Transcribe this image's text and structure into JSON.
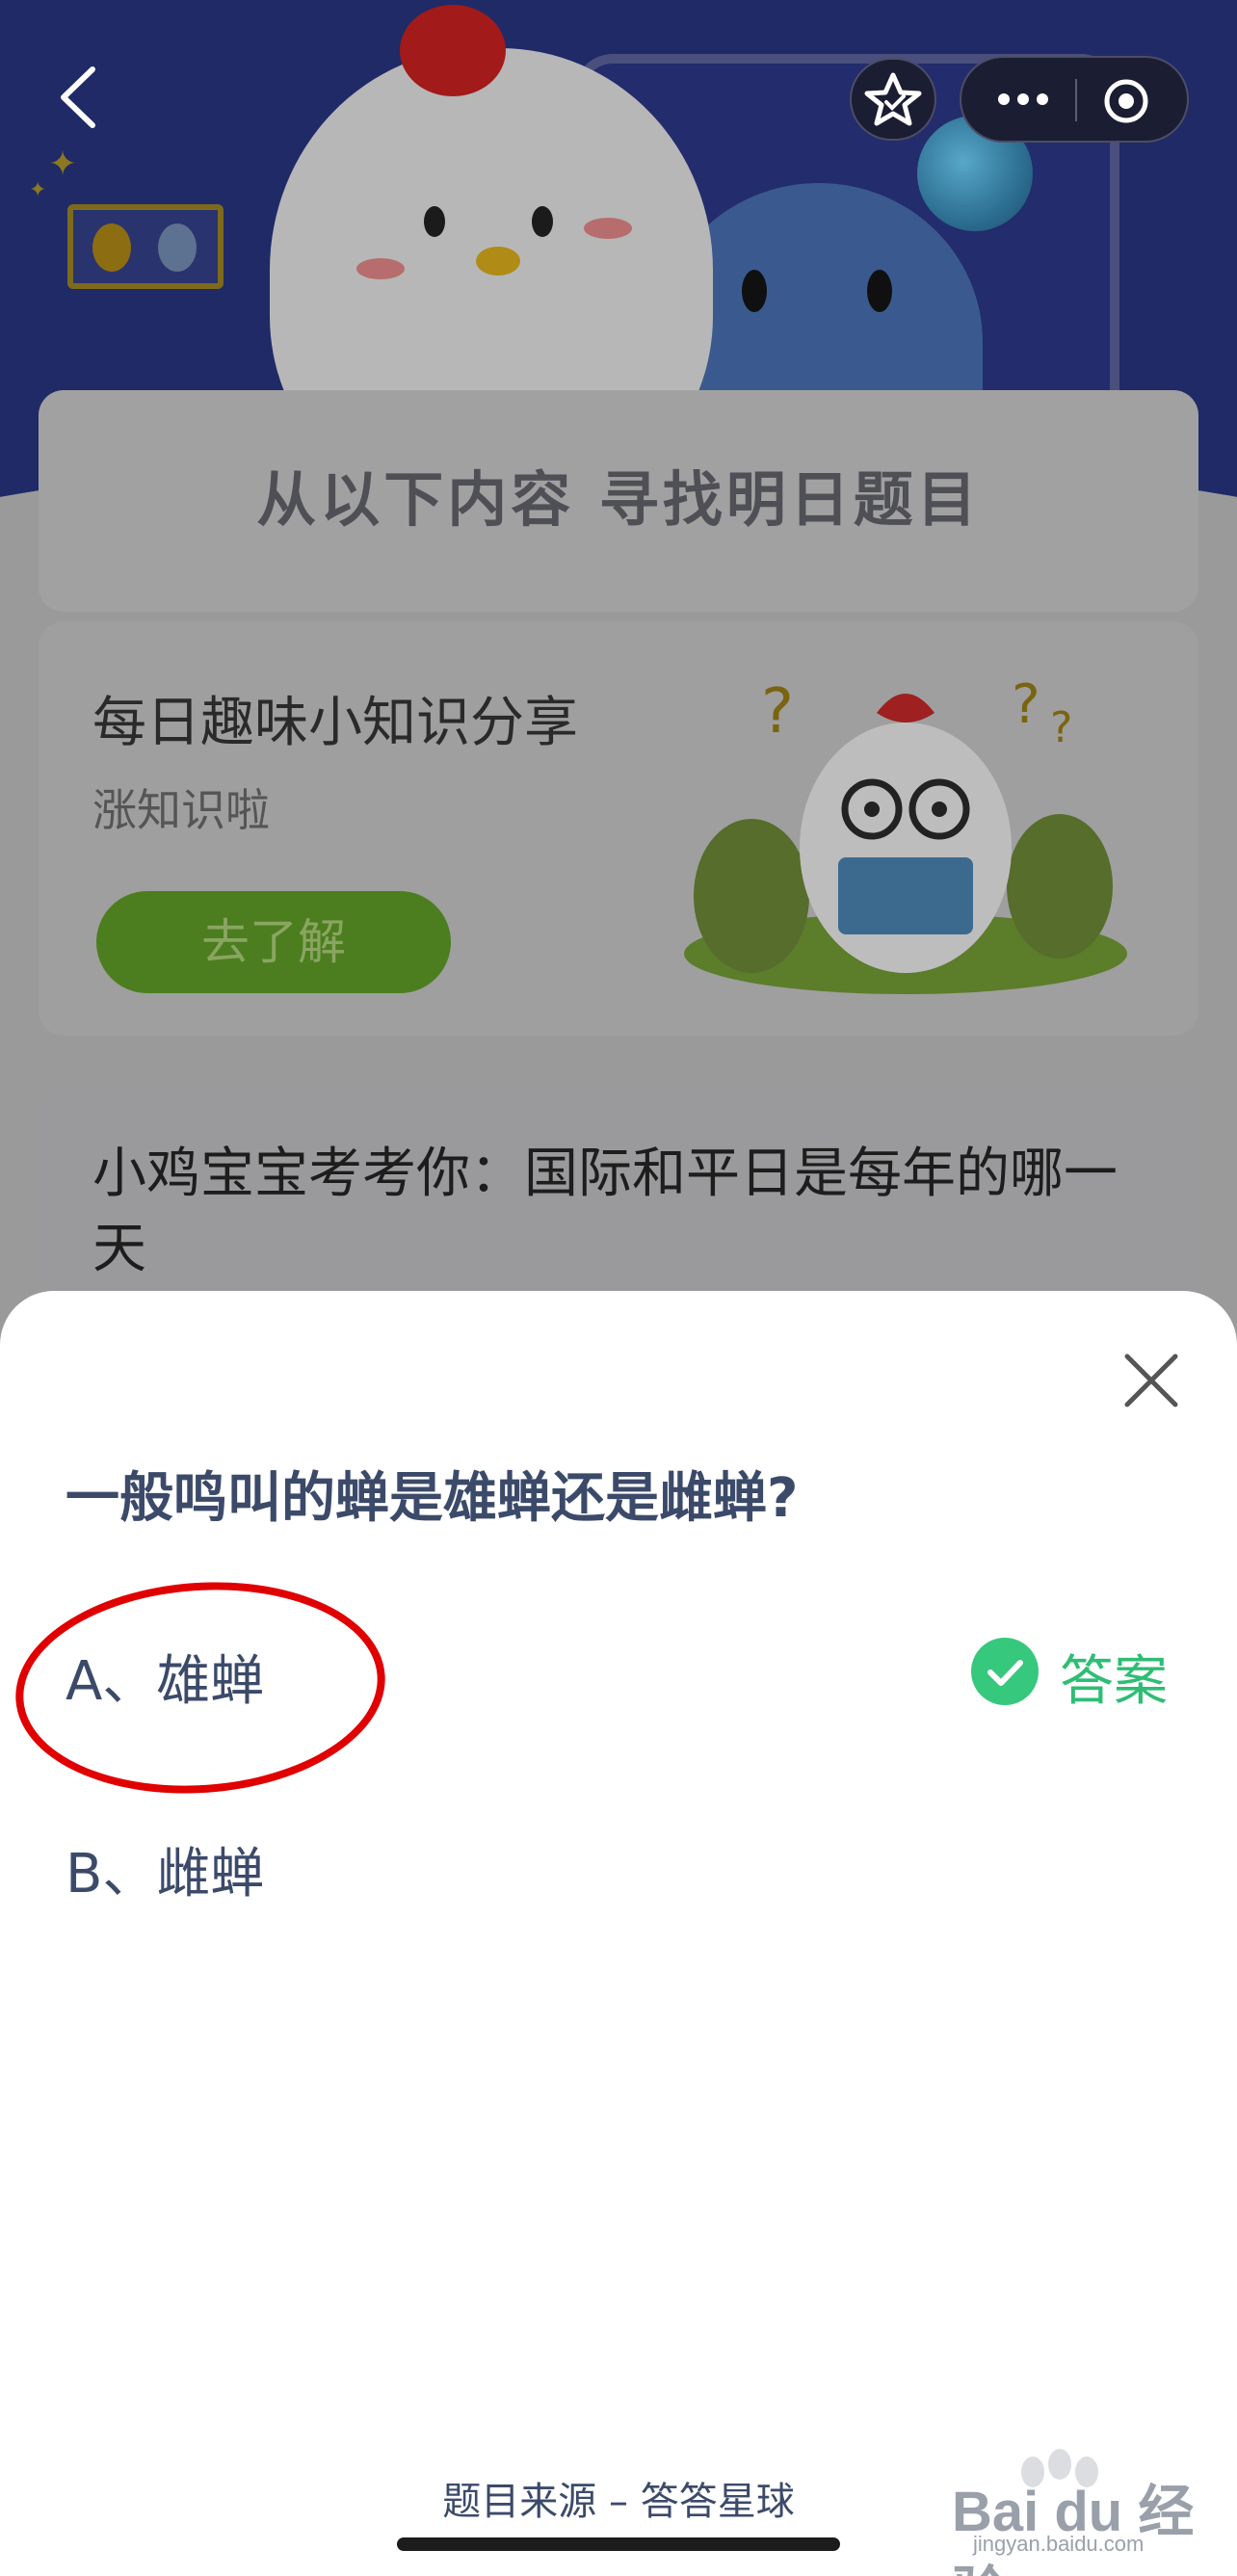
{
  "background": {
    "section_title": "从以下内容  寻找明日题目",
    "knowledge_card": {
      "title": "每日趣味小知识分享",
      "subtitle": "涨知识啦",
      "button_label": "去了解"
    },
    "question_card": {
      "text": "小鸡宝宝考考你：国际和平日是每年的哪一天"
    }
  },
  "nav": {
    "back_icon": "chevron-left-icon",
    "favorite_icon": "star-icon",
    "more_icon": "more-dots-icon",
    "close_miniprogram_icon": "target-icon"
  },
  "sheet": {
    "question": "一般鸣叫的蝉是雄蝉还是雌蝉?",
    "options": [
      {
        "label": "A、雄蝉",
        "is_answer": true
      },
      {
        "label": "B、雌蝉",
        "is_answer": false
      }
    ],
    "answer_label": "答案",
    "source": "题目来源 – 答答星球",
    "close_icon": "close-icon"
  },
  "watermark": {
    "text": "Bai du 经验",
    "url": "jingyan.baidu.com"
  },
  "colors": {
    "accent_green": "#36c87c",
    "text_dark_blue": "#3c4a6a",
    "highlight_red": "#e10000"
  }
}
